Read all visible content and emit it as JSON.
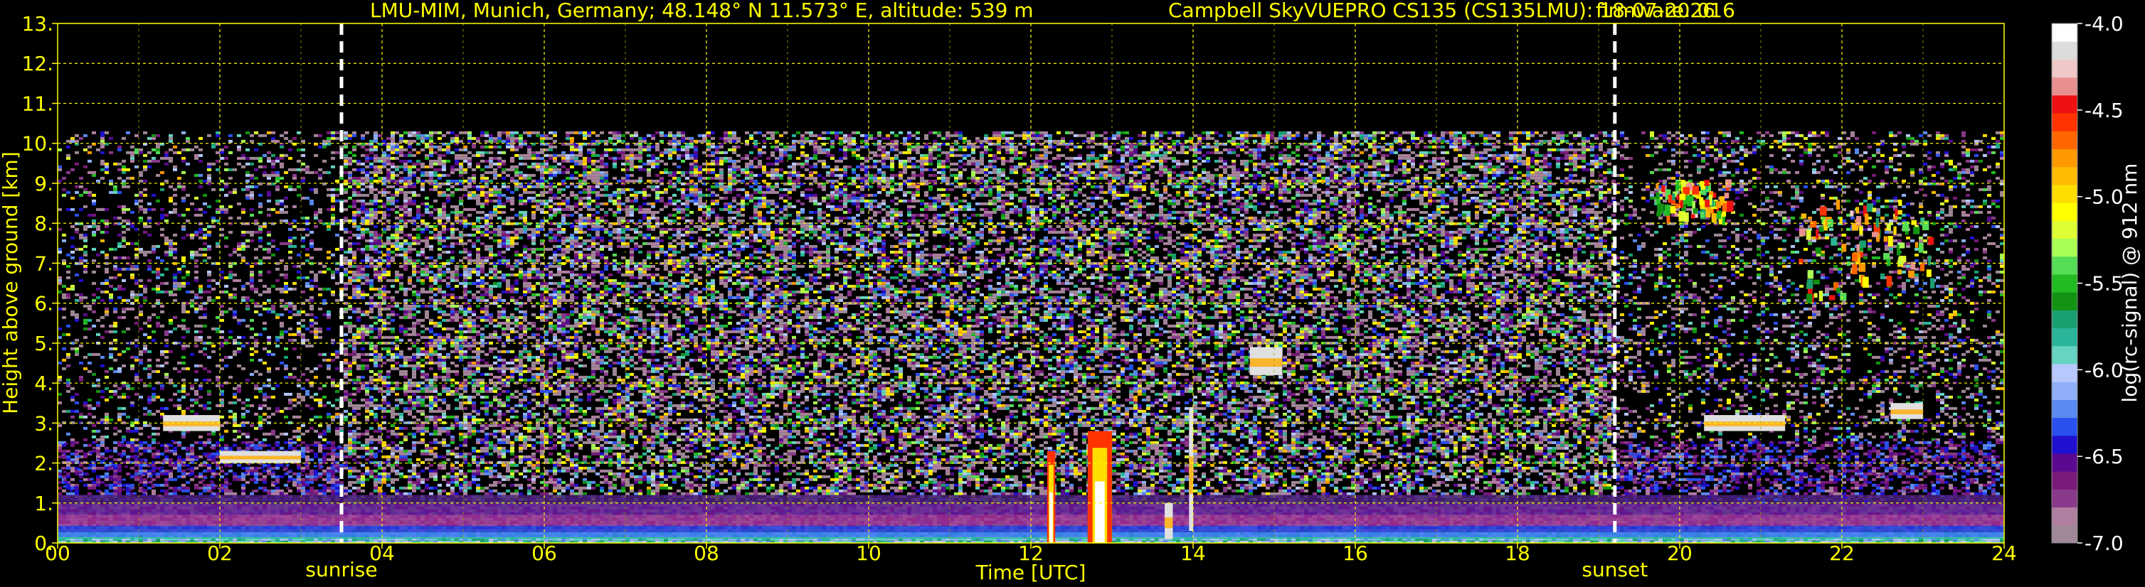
{
  "title": {
    "station": "LMU-MIM, Munich, Germany; 48.148° N 11.573° E, altitude: 539 m",
    "instrument": "Campbell SkyVUEPRO CS135 (CS135LMU): 18-07-2026",
    "firmware": "firmware: 016"
  },
  "chart_data": {
    "type": "heatmap",
    "xlabel": "Time [UTC]",
    "ylabel": "Height above ground [km]",
    "xlim": [
      0,
      24
    ],
    "ylim": [
      0,
      13
    ],
    "x_ticks": [
      0,
      2,
      4,
      6,
      8,
      10,
      12,
      14,
      16,
      18,
      20,
      22,
      24
    ],
    "x_tick_labels": [
      "00",
      "02",
      "04",
      "06",
      "08",
      "10",
      "12",
      "14",
      "16",
      "18",
      "20",
      "22",
      "24"
    ],
    "y_ticks": [
      0,
      1,
      2,
      3,
      4,
      5,
      6,
      7,
      8,
      9,
      10,
      11,
      12,
      13
    ],
    "y_tick_labels": [
      "0.",
      "1.",
      "2.",
      "3.",
      "4.",
      "5.",
      "6.",
      "7.",
      "8.",
      "9.",
      "10.",
      "11.",
      "12.",
      "13."
    ],
    "grid": true,
    "signal_top_km": 10.3,
    "annotations": [
      {
        "label": "sunrise",
        "x": 3.5
      },
      {
        "label": "sunset",
        "x": 19.2
      }
    ],
    "colorbar": {
      "label": "log(rc-signal) @ 912 nm",
      "range": [
        -7.0,
        -4.0
      ],
      "ticks": [
        -4.0,
        -4.5,
        -5.0,
        -5.5,
        -6.0,
        -6.5,
        -7.0
      ],
      "tick_labels": [
        "-4.0",
        "-4.5",
        "-5.0",
        "-5.5",
        "-6.0",
        "-6.5",
        "-7.0"
      ],
      "colors": [
        "#a08898",
        "#b07fa0",
        "#8a3a8a",
        "#7a1a7a",
        "#5a0a90",
        "#2010d0",
        "#2a50f0",
        "#5a8af0",
        "#8fb0f8",
        "#b8c8ff",
        "#66d4c0",
        "#2ab59a",
        "#1aa070",
        "#129412",
        "#22bb22",
        "#55dd55",
        "#aaff55",
        "#ddff33",
        "#ffff00",
        "#ffdd00",
        "#ffbb00",
        "#ff9900",
        "#ff6600",
        "#ff3300",
        "#ee1111",
        "#e89090",
        "#f0c8c8",
        "#dcdcdc",
        "#ffffff"
      ]
    },
    "features": [
      {
        "name": "boundary layer",
        "x": [
          0,
          24
        ],
        "y": [
          0.1,
          1.2
        ]
      },
      {
        "name": "residual layer",
        "x": [
          0,
          3.5
        ],
        "y": [
          1.2,
          2.6
        ]
      },
      {
        "name": "cloud",
        "x": [
          1.3,
          2.0
        ],
        "y": [
          2.8,
          3.2
        ]
      },
      {
        "name": "cloud",
        "x": [
          2.0,
          3.0
        ],
        "y": [
          2.0,
          2.3
        ]
      },
      {
        "name": "precipitation",
        "x": [
          12.2,
          12.3
        ],
        "y": [
          0.0,
          2.3
        ]
      },
      {
        "name": "precipitation",
        "x": [
          12.7,
          13.0
        ],
        "y": [
          0.0,
          2.8
        ]
      },
      {
        "name": "cloud",
        "x": [
          13.95,
          14.0
        ],
        "y": [
          0.3,
          3.4
        ]
      },
      {
        "name": "cloud",
        "x": [
          13.65,
          13.75
        ],
        "y": [
          0.1,
          1.0
        ]
      },
      {
        "name": "cloud",
        "x": [
          14.7,
          15.1
        ],
        "y": [
          4.2,
          4.9
        ]
      },
      {
        "name": "cirrus",
        "x": [
          19.7,
          20.6
        ],
        "y": [
          8.2,
          9.1
        ]
      },
      {
        "name": "cirrus",
        "x": [
          21.4,
          23.1
        ],
        "y": [
          6.2,
          8.6
        ]
      },
      {
        "name": "cloud",
        "x": [
          20.3,
          21.3
        ],
        "y": [
          2.8,
          3.2
        ]
      },
      {
        "name": "cloud",
        "x": [
          22.6,
          23.0
        ],
        "y": [
          3.1,
          3.5
        ]
      },
      {
        "name": "residual layer",
        "x": [
          19.2,
          24
        ],
        "y": [
          1.0,
          2.6
        ]
      }
    ]
  }
}
